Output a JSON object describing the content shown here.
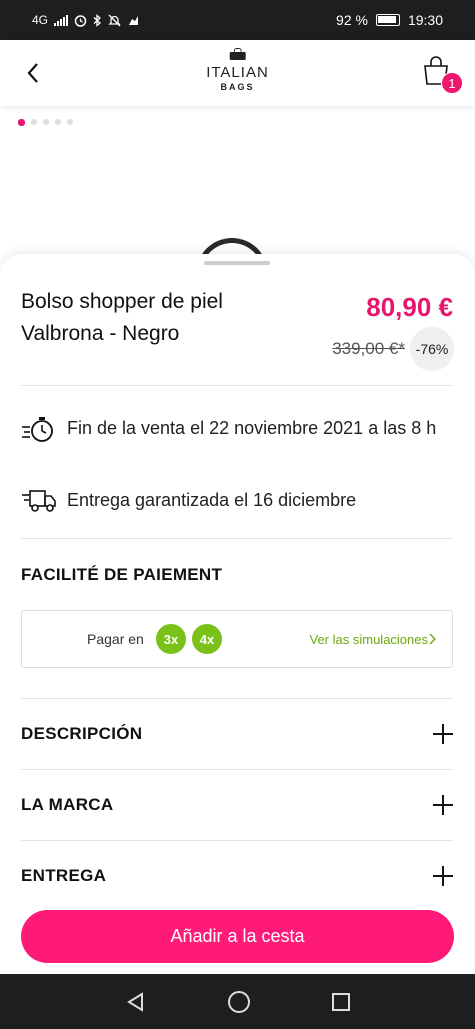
{
  "status_bar": {
    "network": "4G",
    "battery_percent": "92 %",
    "time": "19:30"
  },
  "header": {
    "logo_name": "ITALIAN",
    "logo_sub": "BAGS",
    "cart_count": "1"
  },
  "gallery": {
    "image_count": 5,
    "active_index": 0
  },
  "product": {
    "title": "Bolso shopper de piel Valbrona - Negro",
    "price": "80,90 €",
    "old_price": "339,00 €*",
    "discount": "-76%"
  },
  "info": {
    "sale_end": "Fin de la venta el 22 noviembre 2021 a las 8 h",
    "delivery": "Entrega garantizada el 16 diciembre"
  },
  "payment": {
    "section_title": "FACILITÉ DE PAIEMENT",
    "label": "Pagar en",
    "option_3x": "3x",
    "option_4x": "4x",
    "link": "Ver las simulaciones"
  },
  "accordions": [
    {
      "label": "DESCRIPCIÓN"
    },
    {
      "label": "LA MARCA"
    },
    {
      "label": "ENTREGA"
    }
  ],
  "cta": {
    "label": "Añadir a la cesta"
  },
  "colors": {
    "accent": "#e6166f",
    "cta": "#ff1a7a",
    "payment_green": "#7ac11a"
  }
}
